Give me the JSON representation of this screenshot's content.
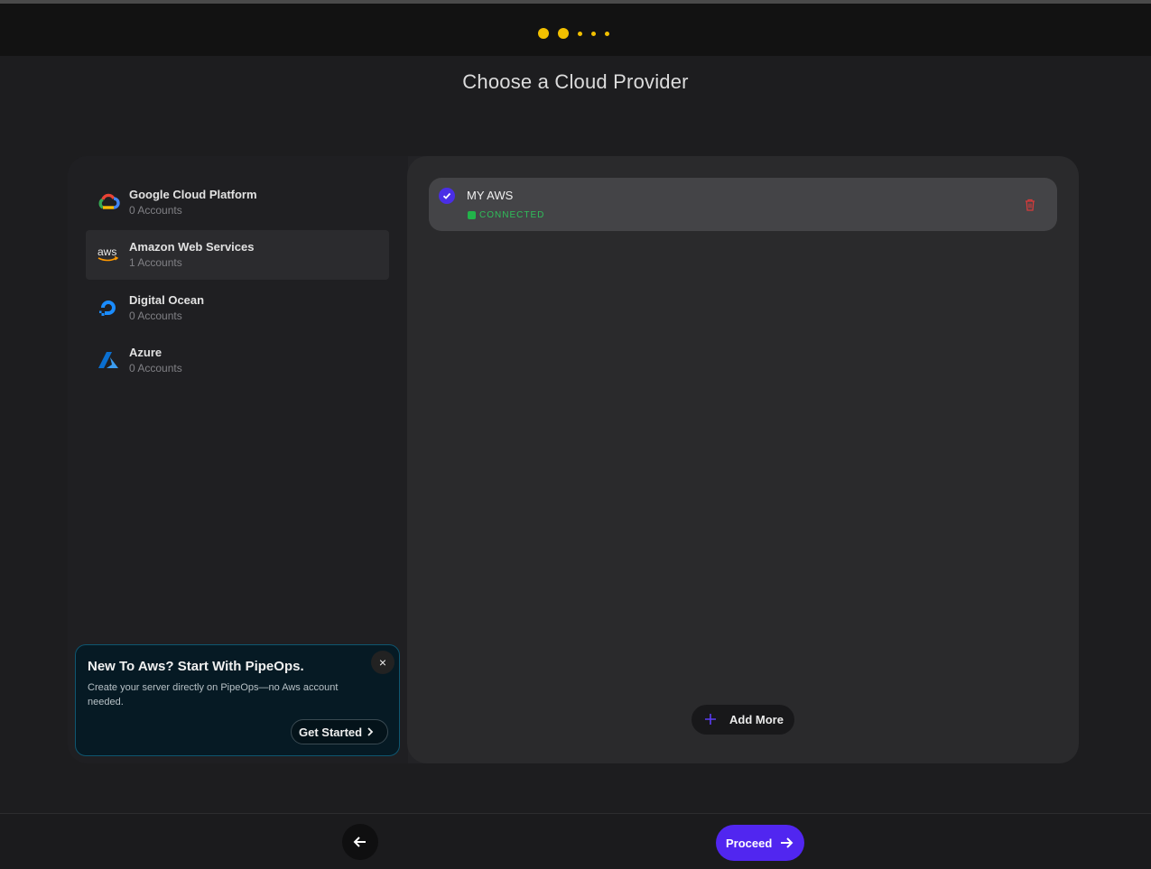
{
  "header": {
    "step_dots": [
      {
        "size": "big",
        "state": "complete"
      },
      {
        "size": "big",
        "state": "complete"
      },
      {
        "size": "small",
        "state": "pending"
      },
      {
        "size": "small",
        "state": "pending"
      },
      {
        "size": "small",
        "state": "pending"
      }
    ],
    "accent_color": "#f2c000"
  },
  "page": {
    "title": "Choose a Cloud Provider"
  },
  "providers": [
    {
      "name": "Google Cloud Platform",
      "accounts": "0 Accounts",
      "icon": "google-cloud-icon",
      "active": false
    },
    {
      "name": "Amazon Web Services",
      "accounts": "1 Accounts",
      "icon": "aws-icon",
      "active": true
    },
    {
      "name": "Digital Ocean",
      "accounts": "0 Accounts",
      "icon": "digital-ocean-icon",
      "active": false
    },
    {
      "name": "Azure",
      "accounts": "0 Accounts",
      "icon": "azure-icon",
      "active": false
    }
  ],
  "aws_logo_text": "aws",
  "promo": {
    "title": "New To Aws? Start With PipeOps.",
    "description": "Create your server directly on PipeOps—no Aws account needed.",
    "close_glyph": "×",
    "button_label": "Get Started"
  },
  "accounts": [
    {
      "name": "MY AWS",
      "status": "CONNECTED",
      "selected": true,
      "status_color": "#2fbf5a"
    }
  ],
  "actions": {
    "add_more_label": "Add More",
    "proceed_label": "Proceed"
  },
  "colors": {
    "primary": "#5126f0",
    "success": "#22b34a",
    "danger": "#e03a3a"
  }
}
